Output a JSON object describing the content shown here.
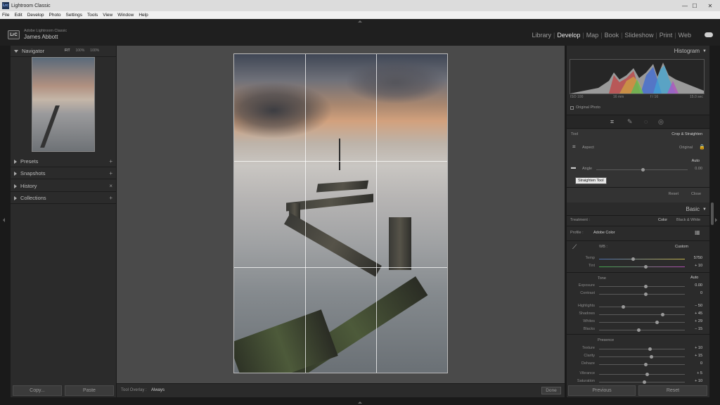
{
  "window": {
    "title": "Lightroom Classic",
    "app_icon": "Lrc"
  },
  "menu": [
    "File",
    "Edit",
    "Develop",
    "Photo",
    "Settings",
    "Tools",
    "View",
    "Window",
    "Help"
  ],
  "identity": {
    "badge": "LrC",
    "product": "Adobe Lightroom Classic",
    "user": "James Abbott"
  },
  "modules": {
    "items": [
      "Library",
      "Develop",
      "Map",
      "Book",
      "Slideshow",
      "Print",
      "Web"
    ],
    "active": "Develop"
  },
  "left_panel": {
    "navigator": {
      "title": "Navigator",
      "zoom": [
        "FIT",
        "100%",
        "100%"
      ]
    },
    "sections": [
      {
        "title": "Presets",
        "action": "+"
      },
      {
        "title": "Snapshots",
        "action": "+"
      },
      {
        "title": "History",
        "action": "×"
      },
      {
        "title": "Collections",
        "action": "+"
      }
    ],
    "copy_label": "Copy...",
    "paste_label": "Paste"
  },
  "toolbar": {
    "overlay_label": "Tool Overlay :",
    "overlay_value": "Always",
    "done_label": "Done"
  },
  "right_panel": {
    "histogram": {
      "title": "Histogram",
      "info": [
        "ISO 100",
        "16 mm",
        "f / 16",
        "15.0 sec"
      ],
      "original_photo": "Original Photo"
    },
    "crop": {
      "tool_label": "Tool",
      "tool_name": "Crop & Straighten",
      "aspect_label": "Aspect",
      "aspect_value": "Original",
      "auto_label": "Auto",
      "angle_label": "Angle",
      "angle_value": "0.00",
      "tooltip": "Straighten Tool",
      "reset_label": "Reset",
      "close_label": "Close"
    },
    "basic": {
      "title": "Basic",
      "treatment_label": "Treatment :",
      "treatment_options": [
        "Color",
        "Black & White"
      ],
      "profile_label": "Profile :",
      "profile_value": "Adobe Color",
      "wb_label": "WB :",
      "wb_value": "Custom",
      "temp": {
        "label": "Temp",
        "value": "5750"
      },
      "tint": {
        "label": "Tint",
        "value": "+ 10"
      },
      "tone_label": "Tone",
      "tone_auto": "Auto",
      "sliders": [
        {
          "label": "Exposure",
          "value": "0.00"
        },
        {
          "label": "Contrast",
          "value": "0"
        },
        {
          "label": "Highlights",
          "value": "− 50"
        },
        {
          "label": "Shadows",
          "value": "+ 45"
        },
        {
          "label": "Whites",
          "value": "+ 29"
        },
        {
          "label": "Blacks",
          "value": "− 15"
        }
      ],
      "presence_label": "Presence",
      "presence_sliders": [
        {
          "label": "Texture",
          "value": "+ 10"
        },
        {
          "label": "Clarity",
          "value": "+ 15"
        },
        {
          "label": "Dehaze",
          "value": "0"
        },
        {
          "label": "Vibrance",
          "value": "+ 5"
        },
        {
          "label": "Saturation",
          "value": "+ 10"
        }
      ]
    },
    "previous_label": "Previous",
    "reset_label": "Reset"
  },
  "colors": {
    "accent": "#e8e8e8",
    "panel": "#2b2b2b",
    "canvas": "#4a4a4a"
  }
}
